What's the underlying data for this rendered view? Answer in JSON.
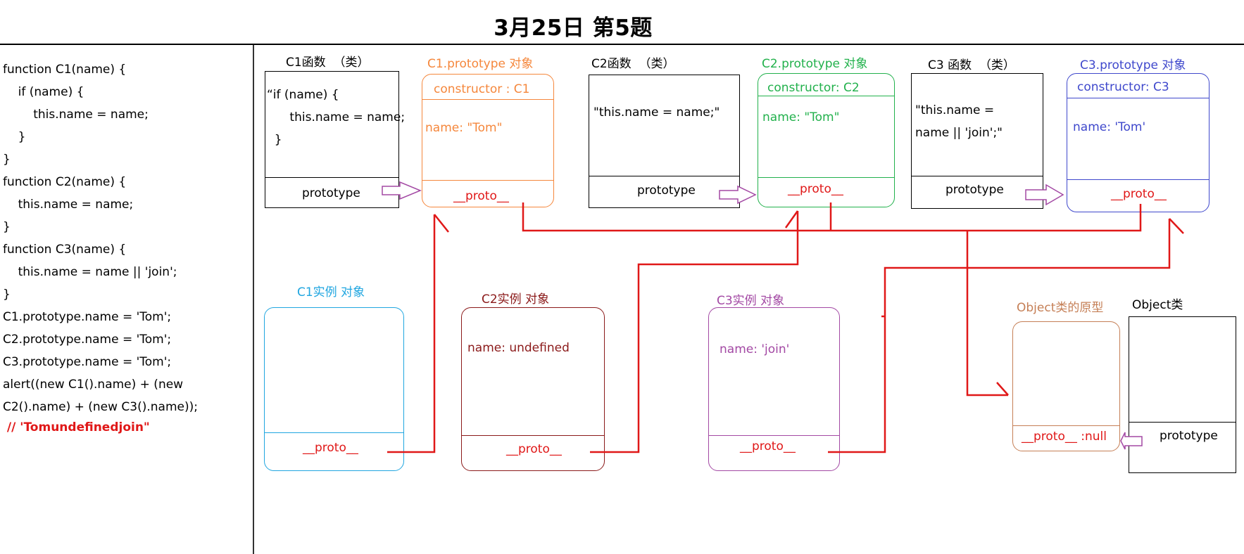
{
  "title": "3月25日 第5题",
  "code": {
    "lines": [
      "function C1(name) {",
      "    if (name) {",
      "        this.name = name;",
      "    }",
      "}",
      "function C2(name) {",
      "    this.name = name;",
      "}",
      "function C3(name) {",
      "    this.name = name || 'join';",
      "}",
      "C1.prototype.name = 'Tom';",
      "C2.prototype.name = 'Tom';",
      "C3.prototype.name = 'Tom';",
      "alert((new C1().name) + (new",
      "C2().name) + (new C3().name));",
      " // 'Tomundefinedjoin\""
    ]
  },
  "c1_func": {
    "heading": "C1函数  （类）",
    "body_lines": [
      "“if (name) {",
      "      this.name = name;",
      "  }"
    ],
    "prototype": "prototype"
  },
  "c1_proto": {
    "heading": "C1.prototype 对象",
    "constructor": "constructor : C1",
    "name": "name: \"Tom\"",
    "proto": "__proto__"
  },
  "c2_func": {
    "heading": "C2函数  （类）",
    "body": "\"this.name = name;\"",
    "prototype": "prototype"
  },
  "c2_proto": {
    "heading": "C2.prototype 对象",
    "constructor": "constructor: C2",
    "name": "name: \"Tom\"",
    "proto": "__proto__"
  },
  "c3_func": {
    "heading": "C3 函数  （类）",
    "body_lines": [
      "\"this.name =",
      "name || 'join';\""
    ],
    "prototype": "prototype"
  },
  "c3_proto": {
    "heading": "C3.prototype 对象",
    "constructor": "constructor: C3",
    "name": "name: 'Tom'",
    "proto": "__proto__"
  },
  "c1_inst": {
    "heading": "C1实例 对象",
    "proto": "__proto__"
  },
  "c2_inst": {
    "heading": "C2实例 对象",
    "name": "name: undefined",
    "proto": "__proto__"
  },
  "c3_inst": {
    "heading": "C3实例 对象",
    "name": "name: 'join'",
    "proto": "__proto__"
  },
  "obj_proto": {
    "heading": "Object类的原型",
    "proto": "__proto__ :null"
  },
  "obj_class": {
    "heading": "Object类",
    "prototype": "prototype"
  },
  "colors": {
    "c1_proto": "#f5873c",
    "c2_proto": "#22b14c",
    "c3_proto": "#3f48cc",
    "c1_inst": "#20a6e0",
    "c2_inst": "#8b1a1a",
    "c3_inst": "#a349a4",
    "obj_proto": "#c57f56",
    "link": "#e01818",
    "arrow": "#a349a4"
  }
}
